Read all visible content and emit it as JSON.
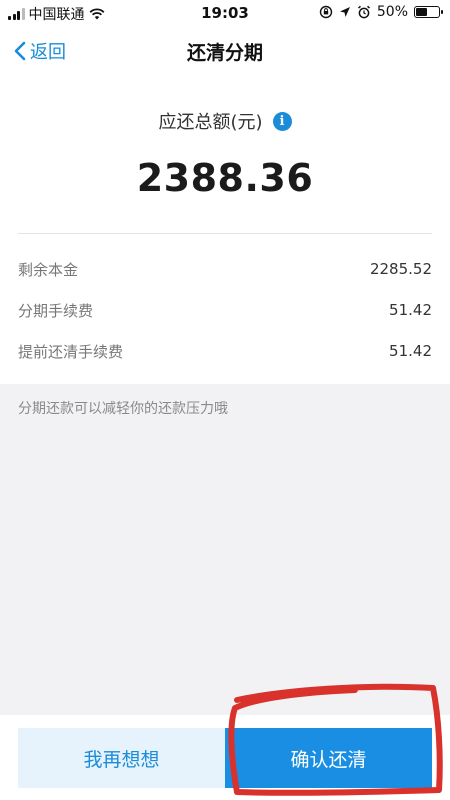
{
  "status_bar": {
    "carrier": "中国联通",
    "time": "19:03",
    "battery": "50%",
    "battery_level": 0.5
  },
  "nav": {
    "back_label": "返回",
    "title": "还清分期"
  },
  "summary": {
    "total_label": "应还总额(元)",
    "info_icon_glyph": "i",
    "total_amount": "2388.36"
  },
  "details": [
    {
      "label": "剩余本金",
      "value": "2285.52"
    },
    {
      "label": "分期手续费",
      "value": "51.42"
    },
    {
      "label": "提前还清手续费",
      "value": "51.42"
    }
  ],
  "hint": "分期还款可以减轻你的还款压力哦",
  "actions": {
    "reconsider_label": "我再想想",
    "confirm_label": "确认还清"
  },
  "colors": {
    "accent": "#1a8cd8",
    "confirm_bg": "#1a8ee2",
    "reconsider_bg": "#e6f3fd",
    "annotation": "#d9312b"
  },
  "icons": [
    "signal-icon",
    "wifi-icon",
    "lock-rotation-icon",
    "location-arrow-icon",
    "alarm-icon",
    "battery-icon",
    "chevron-left-icon",
    "info-icon"
  ]
}
